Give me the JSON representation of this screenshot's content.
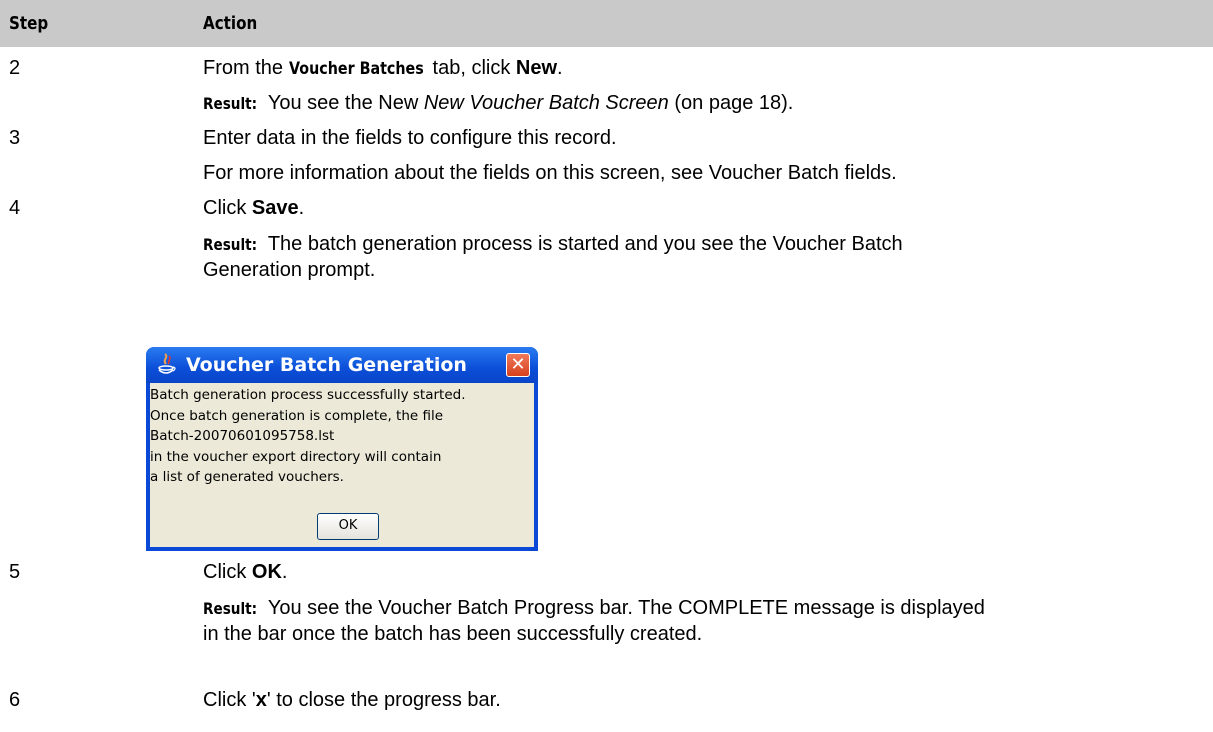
{
  "table": {
    "headers": {
      "step": "Step",
      "action": "Action"
    }
  },
  "steps": {
    "s2": {
      "number": "2",
      "line1": {
        "pre": "From the ",
        "bold_tab": "Voucher Batches",
        "mid": " tab, click ",
        "bold_btn": "New",
        "post": "."
      },
      "result": {
        "label": "Result:",
        "pre": " You see the New ",
        "italic": "New Voucher Batch Screen",
        "post": " (on page 18)."
      }
    },
    "s3": {
      "number": "3",
      "line1": "Enter data in the fields to configure this record.",
      "line2": "For more information about the fields on this screen, see Voucher Batch fields."
    },
    "s4": {
      "number": "4",
      "line1": {
        "pre": "Click ",
        "bold": "Save",
        "post": "."
      },
      "result": {
        "label": "Result:",
        "text1": " The batch generation process is started and you see the Voucher Batch",
        "text2": "Generation prompt."
      }
    },
    "s5": {
      "number": "5",
      "line1": {
        "pre": "Click ",
        "bold": "OK",
        "post": "."
      },
      "result": {
        "label": "Result:",
        "text1": " You see the Voucher Batch Progress bar. The COMPLETE message is displayed",
        "text2": "in the bar once the batch has been successfully created."
      }
    },
    "s6": {
      "number": "6",
      "line1": {
        "pre": "Click '",
        "bold": "x",
        "post": "' to close the progress bar."
      }
    }
  },
  "dialog": {
    "title": "Voucher Batch Generation",
    "close_glyph": "✕",
    "lines": [
      "Batch generation process successfully started.",
      "Once batch generation is complete, the file",
      "Batch-20070601095758.lst",
      "in the voucher export directory will contain",
      "a list of generated vouchers."
    ],
    "ok_label": "OK"
  }
}
